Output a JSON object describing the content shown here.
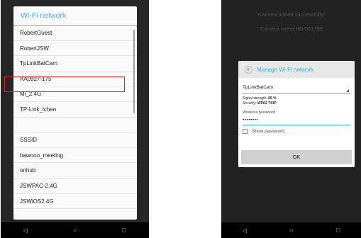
{
  "left_screen": {
    "dialog_title": "Wi-Fi network",
    "networks": [
      "RobertGuest",
      "RobertJSW",
      "TpLinkBatCam",
      "AA0927-175",
      "Mi_2.4G",
      "TP-Link_lchen",
      "",
      "SSSID",
      "hawooo_meeting",
      "onhub",
      "JSWPAC-2.4G",
      "JSWiOS2.4G"
    ],
    "highlighted_network": "AA0927-175"
  },
  "right_screen": {
    "toast_1": "Camera added successfully!",
    "toast_2": "Camera name:HD-001798",
    "dialog_title": "Manage Wi-Fi network",
    "selected_ssid": "TpLinkBatCam",
    "signal_label": "Signal strength: ",
    "signal_value": "69 %",
    "security_label": "Security: ",
    "security_value": "WPA2 TKIP",
    "password_label": "Wireless password",
    "password_value": "••••••••",
    "show_password_label": "Show password.",
    "ok_label": "OK"
  },
  "navbar": {
    "back_icon": "◁",
    "home_icon": "○",
    "recent_icon": "□"
  },
  "colors": {
    "accent": "#33b5e5",
    "highlight": "#e02424"
  }
}
